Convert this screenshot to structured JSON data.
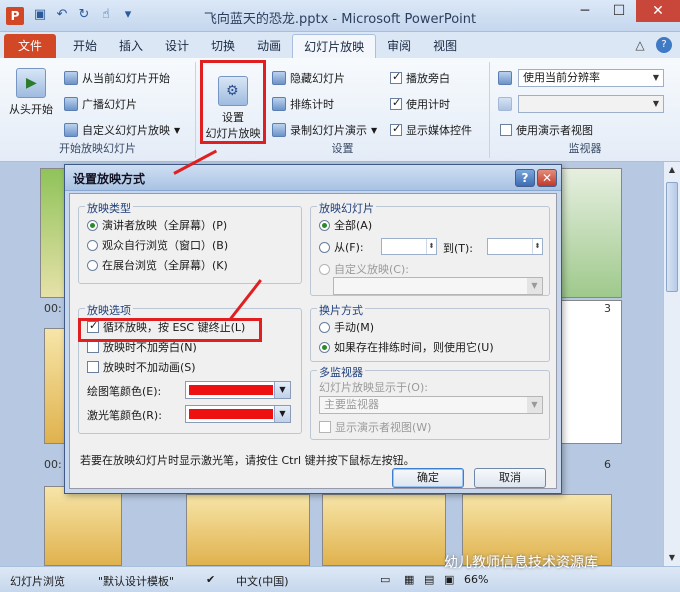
{
  "window": {
    "title": "飞向蓝天的恐龙.pptx - Microsoft PowerPoint",
    "app_icon": "P"
  },
  "tabs": {
    "file": "文件",
    "items": [
      "开始",
      "插入",
      "设计",
      "切换",
      "动画",
      "幻灯片放映",
      "审阅",
      "视图"
    ],
    "active": "幻灯片放映"
  },
  "ribbon": {
    "group_start": {
      "label": "开始放映幻灯片",
      "from_start": "从头开始",
      "from_current": "从当前幻灯片开始",
      "broadcast": "广播幻灯片",
      "custom": "自定义幻灯片放映"
    },
    "group_setup": {
      "label": "设置",
      "setup_line1": "设置",
      "setup_line2": "幻灯片放映",
      "hide_slide": "隐藏幻灯片",
      "rehearse": "排练计时",
      "record": "录制幻灯片演示",
      "play_narration": "播放旁白",
      "use_timings": "使用计时",
      "show_media": "显示媒体控件"
    },
    "group_monitors": {
      "label": "监视器",
      "resolution": "使用当前分辨率",
      "presenter_view": "使用演示者视图"
    }
  },
  "slides": {
    "numbers": [
      "3",
      "6"
    ],
    "time_labels": [
      "00:",
      "00:"
    ]
  },
  "dialog": {
    "title": "设置放映方式",
    "help": "?",
    "close": "✕",
    "show_type": {
      "legend": "放映类型",
      "options": [
        "演讲者放映（全屏幕）(P)",
        "观众自行浏览（窗口）(B)",
        "在展台浏览（全屏幕）(K)"
      ],
      "selected_index": 0
    },
    "show_slides": {
      "legend": "放映幻灯片",
      "all": "全部(A)",
      "from": "从(F):",
      "to": "到(T):",
      "custom": "自定义放映(C):"
    },
    "show_options": {
      "legend": "放映选项",
      "loop": "循环放映，按 ESC 键终止(L)",
      "no_narration": "放映时不加旁白(N)",
      "no_animation": "放映时不加动画(S)",
      "pen_color": "绘图笔颜色(E):",
      "laser_color": "激光笔颜色(R):",
      "pen_color_value": "#ee1111",
      "laser_color_value": "#ee1111"
    },
    "advance": {
      "legend": "换片方式",
      "manual": "手动(M)",
      "timings": "如果存在排练时间，则使用它(U)"
    },
    "multi_monitor": {
      "legend": "多监视器",
      "show_on": "幻灯片放映显示于(O):",
      "monitor_value": "主要监视器",
      "presenter_view": "显示演示者视图(W)"
    },
    "hint": "若要在放映幻灯片时显示激光笔，请按住 Ctrl 键并按下鼠标左按钮。",
    "ok": "确定",
    "cancel": "取消"
  },
  "status": {
    "view": "幻灯片浏览",
    "theme": "\"默认设计模板\"",
    "language": "中文(中国)",
    "zoom": "66%"
  },
  "watermark": "幼儿教师信息技术资源库",
  "colors": {
    "highlight": "#e02020",
    "file_tab": "#d24726"
  }
}
